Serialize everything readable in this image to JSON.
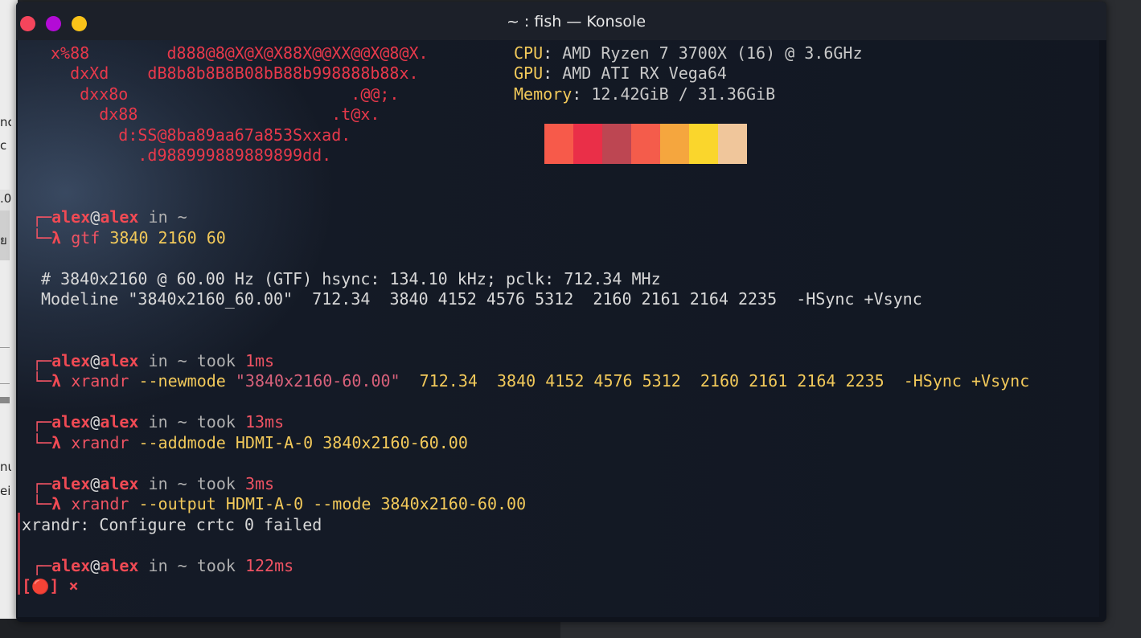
{
  "window": {
    "title": "~ : fish — Konsole",
    "buttons": [
      {
        "name": "close",
        "color": "#f5455c"
      },
      {
        "name": "minimize",
        "color": "#b30bd6"
      },
      {
        "name": "maximize",
        "color": "#f9c319"
      }
    ]
  },
  "background_text": {
    "snippet_1": "nc",
    "snippet_2": "c .",
    "snippet_3": ".0",
    "snippet_4": "ย",
    "snippet_5": "nu",
    "snippet_6": "ei"
  },
  "neofetch": {
    "ascii": [
      "x%88        d888@8@X@X@X88X@@XX@@X@8@X.",
      "  dxXd    dB8b8b8B8B08bB88b998888b88x.",
      "   dxx8o                       .@@;.",
      "     dx88                    .t@x.",
      "       d:SS@8ba89aa67a853Sxxad.",
      "         .d988999889889899dd."
    ],
    "cpu_label": "CPU",
    "cpu_value": " AMD Ryzen 7 3700X (16) @ 3.6GHz",
    "gpu_label": "GPU",
    "gpu_value": " AMD ATI RX Vega64",
    "mem_label": "Memory",
    "mem_value": " 12.42GiB / 31.36GiB",
    "colon": ":",
    "palette": [
      "#f75a4a",
      "#ea2f48",
      "#bd4652",
      "#f45c4b",
      "#f5a63e",
      "#fad62c",
      "#f0c69b"
    ]
  },
  "prompt": {
    "corner_top": "┌─",
    "corner_bottom": "└─",
    "user": "alex",
    "at": "@",
    "host": "alex",
    "in": " in ",
    "dir": "~",
    "took": " took ",
    "lambda": "λ "
  },
  "session": {
    "cmd1": {
      "cmd": "gtf",
      "args": " 3840 2160 60"
    },
    "out1": "# 3840x2160 @ 60.00 Hz (GTF) hsync: 134.10 kHz; pclk: 712.34 MHz",
    "out2": "Modeline \"3840x2160_60.00\"  712.34  3840 4152 4576 5312  2160 2161 2164 2235  -HSync +Vsync",
    "took2": "1ms",
    "cmd2": {
      "cmd": "xrandr",
      "flag": " --newmode ",
      "str": "\"3840x2160-60.00\"",
      "args": "  712.34  3840 4152 4576 5312  2160 2161 2164 2235  -HSync +Vsync"
    },
    "took3": "13ms",
    "cmd3": {
      "cmd": "xrandr",
      "flag": " --addmode ",
      "args": "HDMI-A-0 3840x2160-60.00"
    },
    "took4": "3ms",
    "cmd4": {
      "cmd": "xrandr",
      "flag": " --output ",
      "args": "HDMI-A-0 --mode 3840x2160-60.00"
    },
    "error": "xrandr: Configure crtc 0 failed",
    "took5": "122ms",
    "status_open": "[",
    "status_icon": "🔴",
    "status_close": "]",
    "status_x": " ×"
  }
}
